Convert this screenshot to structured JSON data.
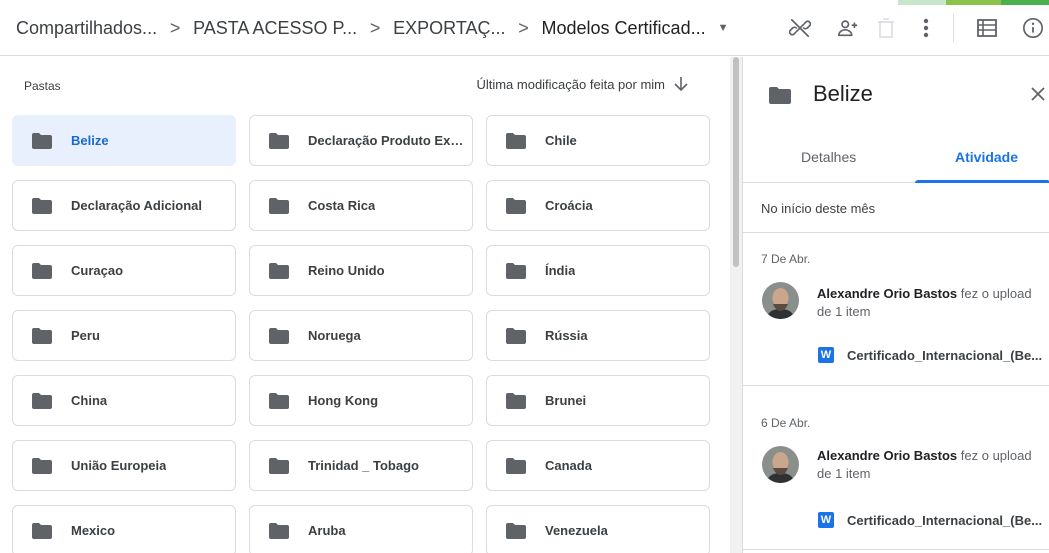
{
  "breadcrumbs": [
    {
      "label": "Compartilhados..."
    },
    {
      "label": "PASTA ACESSO P..."
    },
    {
      "label": "EXPORTAÇ..."
    },
    {
      "label": "Modelos Certificad..."
    }
  ],
  "breadcrumb_separator": ">",
  "toolbar": {
    "icons": [
      "link-icon",
      "add-person-icon",
      "trash-icon",
      "more-vert-icon",
      "list-view-icon",
      "info-icon"
    ]
  },
  "list": {
    "section_label": "Pastas",
    "sort_label": "Última modificação feita por mim",
    "folders": [
      {
        "name": "Belize",
        "selected": true
      },
      {
        "name": "Declaração Produto Exc..."
      },
      {
        "name": "Chile"
      },
      {
        "name": "Declaração Adicional"
      },
      {
        "name": "Costa Rica"
      },
      {
        "name": "Croácia"
      },
      {
        "name": "Curaçao"
      },
      {
        "name": "Reino Unido"
      },
      {
        "name": "Índia"
      },
      {
        "name": "Peru"
      },
      {
        "name": "Noruega"
      },
      {
        "name": "Rússia"
      },
      {
        "name": "China"
      },
      {
        "name": "Hong Kong"
      },
      {
        "name": "Brunei"
      },
      {
        "name": "União Europeia"
      },
      {
        "name": "Trinidad _ Tobago"
      },
      {
        "name": "Canada"
      },
      {
        "name": "Mexico"
      },
      {
        "name": "Aruba"
      },
      {
        "name": "Venezuela"
      }
    ]
  },
  "panel": {
    "title": "Belize",
    "tabs": [
      {
        "label": "Detalhes"
      },
      {
        "label": "Atividade",
        "active": true
      }
    ],
    "section_heading": "No início deste mês",
    "activities": [
      {
        "date": "7 De Abr.",
        "user": "Alexandre Orio Bastos",
        "action": " fez o upload de 1 item",
        "file": "Certificado_Internacional_(Be..."
      },
      {
        "date": "6 De Abr.",
        "user": "Alexandre Orio Bastos",
        "action": " fez o upload de 1 item",
        "file": "Certificado_Internacional_(Be..."
      }
    ],
    "file_type_letter": "W"
  },
  "colors": {
    "accent": "#1a73e8",
    "selected_bg": "#e8f0fe",
    "folder_icon": "#5f6368",
    "border": "#dadce0"
  }
}
